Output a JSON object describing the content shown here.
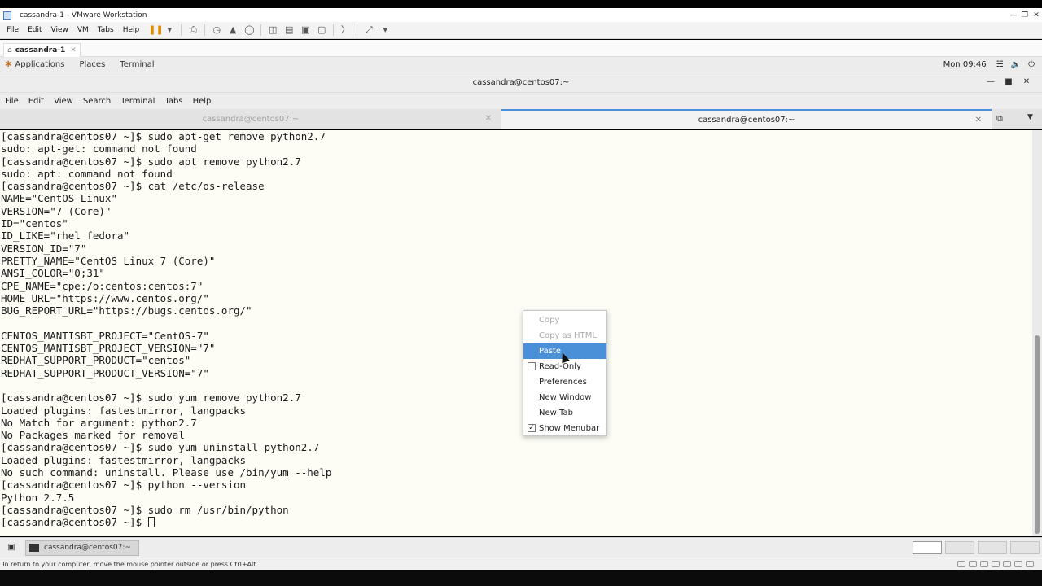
{
  "vmware": {
    "title": "cassandra-1 - VMware Workstation",
    "menu": [
      "File",
      "Edit",
      "View",
      "VM",
      "Tabs",
      "Help"
    ],
    "tab_label": "cassandra-1",
    "status_message": "To return to your computer, move the mouse pointer outside or press Ctrl+Alt."
  },
  "gnome": {
    "applications": "Applications",
    "places": "Places",
    "terminal": "Terminal",
    "clock": "Mon 09:46"
  },
  "terminal": {
    "title": "cassandra@centos07:~",
    "menu": [
      "File",
      "Edit",
      "View",
      "Search",
      "Terminal",
      "Tabs",
      "Help"
    ],
    "tabs": [
      {
        "label": "cassandra@centos07:~",
        "active": false
      },
      {
        "label": "cassandra@centos07:~",
        "active": true
      }
    ],
    "lines": [
      "[cassandra@centos07 ~]$ sudo apt-get remove python2.7",
      "sudo: apt-get: command not found",
      "[cassandra@centos07 ~]$ sudo apt remove python2.7",
      "sudo: apt: command not found",
      "[cassandra@centos07 ~]$ cat /etc/os-release",
      "NAME=\"CentOS Linux\"",
      "VERSION=\"7 (Core)\"",
      "ID=\"centos\"",
      "ID_LIKE=\"rhel fedora\"",
      "VERSION_ID=\"7\"",
      "PRETTY_NAME=\"CentOS Linux 7 (Core)\"",
      "ANSI_COLOR=\"0;31\"",
      "CPE_NAME=\"cpe:/o:centos:centos:7\"",
      "HOME_URL=\"https://www.centos.org/\"",
      "BUG_REPORT_URL=\"https://bugs.centos.org/\"",
      "",
      "CENTOS_MANTISBT_PROJECT=\"CentOS-7\"",
      "CENTOS_MANTISBT_PROJECT_VERSION=\"7\"",
      "REDHAT_SUPPORT_PRODUCT=\"centos\"",
      "REDHAT_SUPPORT_PRODUCT_VERSION=\"7\"",
      "",
      "[cassandra@centos07 ~]$ sudo yum remove python2.7",
      "Loaded plugins: fastestmirror, langpacks",
      "No Match for argument: python2.7",
      "No Packages marked for removal",
      "[cassandra@centos07 ~]$ sudo yum uninstall python2.7",
      "Loaded plugins: fastestmirror, langpacks",
      "No such command: uninstall. Please use /bin/yum --help",
      "[cassandra@centos07 ~]$ python --version",
      "Python 2.7.5",
      "[cassandra@centos07 ~]$ sudo rm /usr/bin/python"
    ],
    "prompt": "[cassandra@centos07 ~]$ "
  },
  "context_menu": {
    "copy": "Copy",
    "copy_html": "Copy as HTML",
    "paste": "Paste",
    "read_only": "Read-Only",
    "preferences": "Preferences",
    "new_window": "New Window",
    "new_tab": "New Tab",
    "show_menubar": "Show Menubar",
    "read_only_checked": false,
    "show_menubar_checked": true
  },
  "taskbar": {
    "task_label": "cassandra@centos07:~"
  },
  "colors": {
    "selection": "#4a90d9",
    "terminal_bg": "#fdfdf6",
    "pause_icon": "#e08a00"
  }
}
